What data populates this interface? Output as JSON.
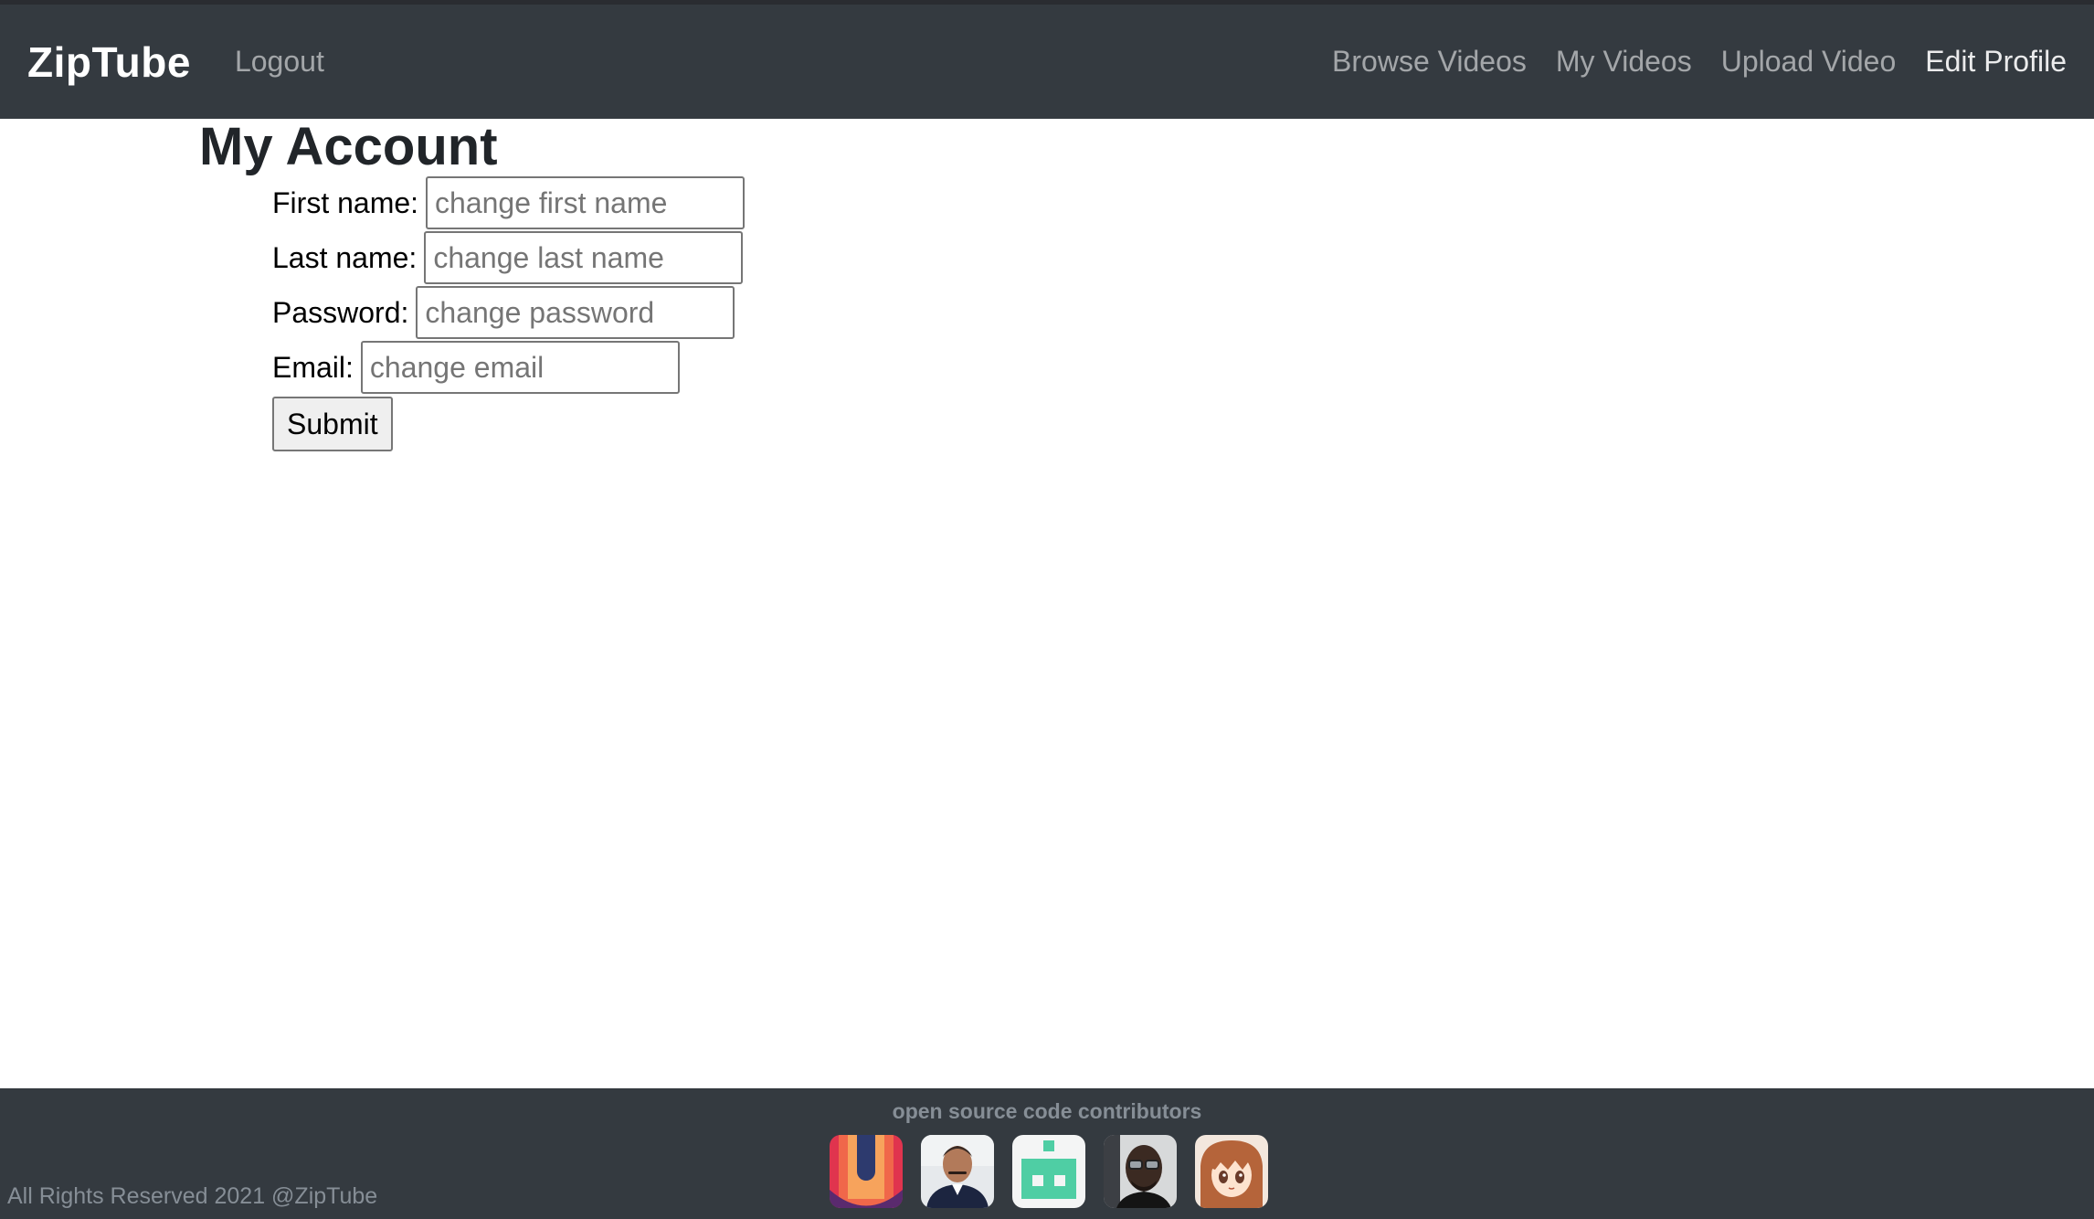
{
  "navbar": {
    "brand": "ZipTube",
    "logout": "Logout",
    "links": [
      "Browse Videos",
      "My Videos",
      "Upload Video",
      "Edit Profile"
    ],
    "active_link": "Edit Profile"
  },
  "main": {
    "title": "My Account",
    "form": {
      "first_name": {
        "label": "First name:",
        "placeholder": "change first name",
        "value": ""
      },
      "last_name": {
        "label": "Last name:",
        "placeholder": "change last name",
        "value": ""
      },
      "password": {
        "label": "Password:",
        "placeholder": "change password",
        "value": ""
      },
      "email": {
        "label": "Email:",
        "placeholder": "change email",
        "value": ""
      },
      "submit_label": "Submit"
    }
  },
  "footer": {
    "title": "open source code contributors",
    "contributors": [
      {
        "icon": "contributor-avatar-gradient-logo"
      },
      {
        "icon": "contributor-avatar-man-photo"
      },
      {
        "icon": "contributor-avatar-robot-identicon"
      },
      {
        "icon": "contributor-avatar-man-glasses-photo"
      },
      {
        "icon": "contributor-avatar-anime-girl"
      }
    ],
    "copyright": "All Rights Reserved 2021 @ZipTube"
  },
  "colors": {
    "navbar_bg": "#343a40",
    "footer_bg": "#343a40",
    "nav_link": "rgba(255,255,255,0.55)",
    "identicon_green": "#4fcea4"
  }
}
